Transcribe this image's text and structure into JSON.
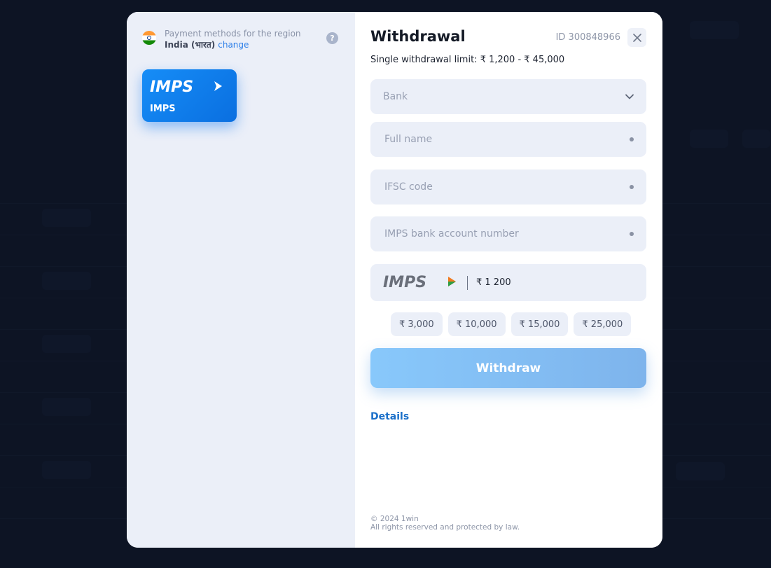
{
  "sidebar": {
    "region_label": "Payment methods for the region",
    "region_country": "India (भारत)",
    "region_change": "change",
    "help_label": "?",
    "methods": [
      {
        "name": "IMPS",
        "icon": "imps-logo"
      }
    ]
  },
  "form": {
    "title": "Withdrawal",
    "user_id": "ID 300848966",
    "limit": "Single withdrawal limit: ₹ 1,200 - ₹ 45,000",
    "bank_placeholder": "Bank",
    "full_name_placeholder": "Full name",
    "ifsc_placeholder": "IFSC code",
    "account_placeholder": "IMPS bank account number",
    "amount_value": "₹ 1 200",
    "quick_amounts": [
      "₹ 3,000",
      "₹ 10,000",
      "₹ 15,000",
      "₹ 25,000"
    ],
    "withdraw_label": "Withdraw",
    "details_label": "Details"
  },
  "footer": {
    "copyright": "© 2024 1win",
    "rights": "All rights reserved and protected by law."
  },
  "colors": {
    "accent": "#2d7fe8",
    "card_blue": "#0a6fe0",
    "button": "#88c8fb",
    "field_bg": "#ebeff8"
  }
}
